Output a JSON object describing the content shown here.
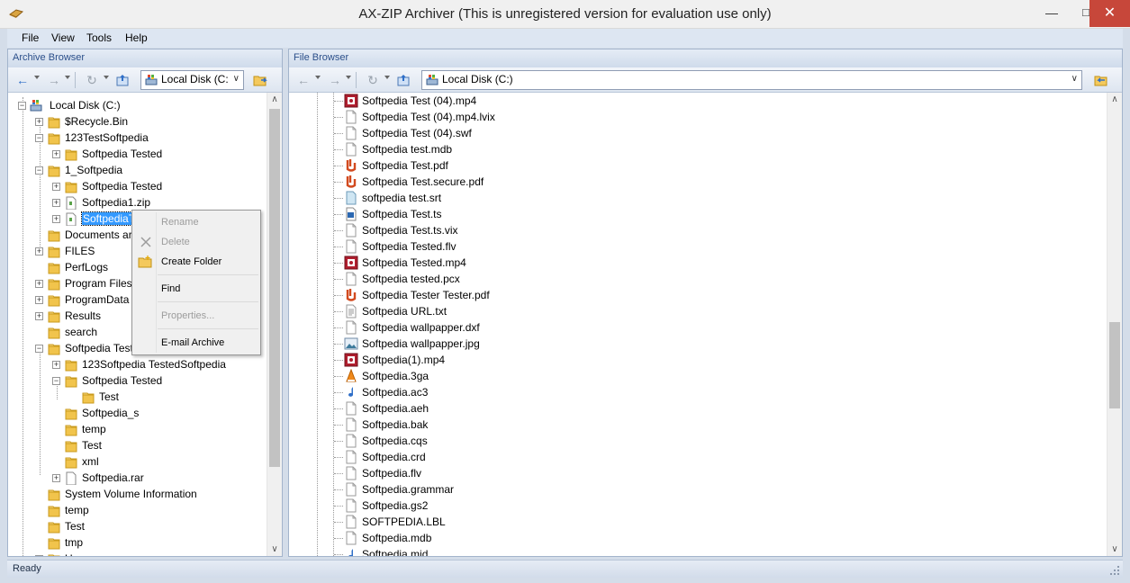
{
  "window": {
    "title": "AX-ZIP Archiver (This is unregistered version for evaluation use only)",
    "min": "—",
    "max": "□",
    "close": "✕"
  },
  "menu": [
    "File",
    "View",
    "Tools",
    "Help"
  ],
  "archive_browser": {
    "title": "Archive Browser",
    "drive": "Local Disk (C:",
    "tree": [
      {
        "label": "Local Disk (C:)",
        "level": 0,
        "expander": "-",
        "icon": "drive-icon"
      },
      {
        "label": "$Recycle.Bin",
        "level": 1,
        "expander": "+",
        "icon": "folder-icon"
      },
      {
        "label": "123TestSoftpedia",
        "level": 1,
        "expander": "-",
        "icon": "folder-icon"
      },
      {
        "label": "Softpedia Tested",
        "level": 2,
        "expander": "+",
        "icon": "folder-icon"
      },
      {
        "label": "1_Softpedia",
        "level": 1,
        "expander": "-",
        "icon": "folder-icon"
      },
      {
        "label": "Softpedia Tested",
        "level": 2,
        "expander": "+",
        "icon": "folder-icon"
      },
      {
        "label": "Softpedia1.zip",
        "level": 2,
        "expander": "+",
        "icon": "zip-file-icon"
      },
      {
        "label": "SoftpediaTe",
        "level": 2,
        "expander": "+",
        "icon": "zip-file-icon",
        "selected": true
      },
      {
        "label": "Documents ar",
        "level": 1,
        "expander": "",
        "icon": "folder-icon"
      },
      {
        "label": "FILES",
        "level": 1,
        "expander": "+",
        "icon": "folder-icon"
      },
      {
        "label": "PerfLogs",
        "level": 1,
        "expander": "",
        "icon": "folder-icon"
      },
      {
        "label": "Program Files",
        "level": 1,
        "expander": "+",
        "icon": "folder-icon"
      },
      {
        "label": "ProgramData",
        "level": 1,
        "expander": "+",
        "icon": "folder-icon"
      },
      {
        "label": "Results",
        "level": 1,
        "expander": "+",
        "icon": "folder-icon"
      },
      {
        "label": "search",
        "level": 1,
        "expander": "",
        "icon": "folder-icon"
      },
      {
        "label": "Softpedia Test",
        "level": 1,
        "expander": "-",
        "icon": "folder-icon"
      },
      {
        "label": "123Softpedia TestedSoftpedia",
        "level": 2,
        "expander": "+",
        "icon": "folder-icon"
      },
      {
        "label": "Softpedia Tested",
        "level": 2,
        "expander": "-",
        "icon": "folder-icon"
      },
      {
        "label": "Test",
        "level": 3,
        "expander": "",
        "icon": "folder-icon"
      },
      {
        "label": "Softpedia_s",
        "level": 2,
        "expander": "",
        "icon": "folder-icon"
      },
      {
        "label": "temp",
        "level": 2,
        "expander": "",
        "icon": "folder-icon"
      },
      {
        "label": "Test",
        "level": 2,
        "expander": "",
        "icon": "folder-icon"
      },
      {
        "label": "xml",
        "level": 2,
        "expander": "",
        "icon": "folder-icon"
      },
      {
        "label": "Softpedia.rar",
        "level": 2,
        "expander": "+",
        "icon": "file-icon"
      },
      {
        "label": "System Volume Information",
        "level": 1,
        "expander": "",
        "icon": "folder-icon"
      },
      {
        "label": "temp",
        "level": 1,
        "expander": "",
        "icon": "folder-icon"
      },
      {
        "label": "Test",
        "level": 1,
        "expander": "",
        "icon": "folder-icon"
      },
      {
        "label": "tmp",
        "level": 1,
        "expander": "",
        "icon": "folder-icon"
      },
      {
        "label": "Users",
        "level": 1,
        "expander": "+",
        "icon": "folder-icon"
      }
    ]
  },
  "context_menu": {
    "rename": "Rename",
    "delete": "Delete",
    "create_folder": "Create Folder",
    "find": "Find",
    "properties": "Properties...",
    "email": "E-mail Archive"
  },
  "file_browser": {
    "title": "File Browser",
    "drive": "Local Disk (C:)",
    "files": [
      {
        "name": "Softpedia Test (04).mp4",
        "icon": "video-icon"
      },
      {
        "name": "Softpedia Test (04).mp4.lvix",
        "icon": "blank-file-icon"
      },
      {
        "name": "Softpedia Test (04).swf",
        "icon": "blank-file-icon"
      },
      {
        "name": "Softpedia test.mdb",
        "icon": "blank-file-icon"
      },
      {
        "name": "Softpedia Test.pdf",
        "icon": "pdf-icon"
      },
      {
        "name": "Softpedia Test.secure.pdf",
        "icon": "pdf-icon"
      },
      {
        "name": "softpedia test.srt",
        "icon": "subtitle-icon"
      },
      {
        "name": "Softpedia Test.ts",
        "icon": "ts-icon"
      },
      {
        "name": "Softpedia Test.ts.vix",
        "icon": "blank-file-icon"
      },
      {
        "name": "Softpedia Tested.flv",
        "icon": "blank-file-icon"
      },
      {
        "name": "Softpedia Tested.mp4",
        "icon": "video-icon"
      },
      {
        "name": "Softpedia tested.pcx",
        "icon": "blank-file-icon"
      },
      {
        "name": "Softpedia Tester Tester.pdf",
        "icon": "pdf-icon"
      },
      {
        "name": "Softpedia URL.txt",
        "icon": "text-icon"
      },
      {
        "name": "Softpedia wallpapper.dxf",
        "icon": "blank-file-icon"
      },
      {
        "name": "Softpedia wallpapper.jpg",
        "icon": "image-icon"
      },
      {
        "name": "Softpedia(1).mp4",
        "icon": "video-icon"
      },
      {
        "name": "Softpedia.3ga",
        "icon": "vlc-icon"
      },
      {
        "name": "Softpedia.ac3",
        "icon": "audio-icon"
      },
      {
        "name": "Softpedia.aeh",
        "icon": "blank-file-icon"
      },
      {
        "name": "Softpedia.bak",
        "icon": "blank-file-icon"
      },
      {
        "name": "Softpedia.cqs",
        "icon": "blank-file-icon"
      },
      {
        "name": "Softpedia.crd",
        "icon": "blank-file-icon"
      },
      {
        "name": "Softpedia.flv",
        "icon": "blank-file-icon"
      },
      {
        "name": "Softpedia.grammar",
        "icon": "blank-file-icon"
      },
      {
        "name": "Softpedia.gs2",
        "icon": "blank-file-icon"
      },
      {
        "name": "SOFTPEDIA.LBL",
        "icon": "blank-file-icon"
      },
      {
        "name": "Softpedia.mdb",
        "icon": "blank-file-icon"
      },
      {
        "name": "Softpedia.mid",
        "icon": "audio-icon"
      }
    ]
  },
  "status": "Ready"
}
